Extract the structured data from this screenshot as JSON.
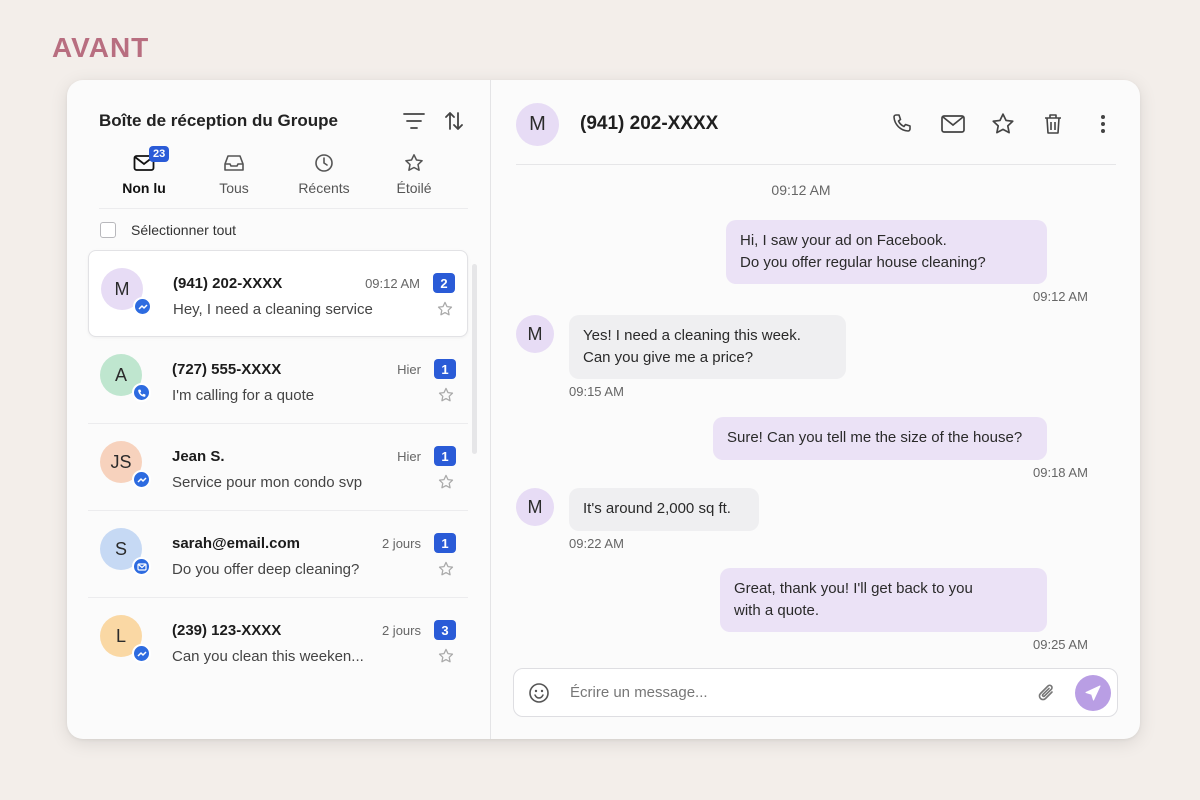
{
  "brand": {
    "label": "AVANT"
  },
  "inbox": {
    "title": "Boîte de réception du Groupe",
    "tabs": [
      {
        "label": "Non lu",
        "badge": "23",
        "icon": "mail-icon"
      },
      {
        "label": "Tous",
        "icon": "inbox-icon"
      },
      {
        "label": "Récents",
        "icon": "clock-icon"
      },
      {
        "label": "Étoilé",
        "icon": "star-icon"
      }
    ],
    "select_all": "Sélectionner tout",
    "conversations": [
      {
        "initial": "M",
        "name": "(941) 202-XXXX",
        "time": "09:12 AM",
        "badge": "2",
        "message": "Hey, I need a cleaning service",
        "avatar_color": "#e7dcf5",
        "channel": "messenger-icon"
      },
      {
        "initial": "A",
        "name": "(727) 555-XXXX",
        "time": "Hier",
        "badge": "1",
        "message": "I'm calling for a quote",
        "avatar_color": "#bfe6cf",
        "channel": "phone-icon"
      },
      {
        "initial": "JS",
        "name": "Jean S.",
        "time": "Hier",
        "badge": "1",
        "message": "Service pour mon condo svp",
        "avatar_color": "#f7d2bd",
        "channel": "messenger-icon"
      },
      {
        "initial": "S",
        "name": "sarah@email.com",
        "time": "2 jours",
        "badge": "1",
        "message": "Do you offer deep cleaning?",
        "avatar_color": "#c6d9f4",
        "channel": "email-icon"
      },
      {
        "initial": "L",
        "name": "(239) 123-XXXX",
        "time": "2 jours",
        "badge": "3",
        "message": "Can you clean this weeken...",
        "avatar_color": "#fad8a4",
        "channel": "messenger-icon"
      }
    ]
  },
  "chat": {
    "avatar_initial": "M",
    "title": "(941) 202-XXXX",
    "day_time": "09:12 AM",
    "messages": [
      {
        "dir": "out",
        "lines": [
          "Hi, I saw your ad on Facebook.",
          "Do you offer regular house cleaning?"
        ],
        "time": "09:12 AM"
      },
      {
        "dir": "in",
        "lines": [
          "Yes! I need a cleaning this week.",
          "Can you give me a price?"
        ],
        "time": "09:15 AM",
        "avatar": "M"
      },
      {
        "dir": "out",
        "lines": [
          "Sure! Can you tell me the size of the house?"
        ],
        "time": "09:18 AM"
      },
      {
        "dir": "in",
        "lines": [
          "It's around 2,000 sq ft."
        ],
        "time": "09:22 AM",
        "avatar": "M"
      },
      {
        "dir": "out",
        "lines": [
          "Great, thank you! I'll get back to you",
          "with a quote."
        ],
        "time": "09:25 AM"
      }
    ],
    "composer_placeholder": "Écrire un message..."
  },
  "colors": {
    "accent": "#2a5bd7",
    "brand": "#b86e80",
    "bubble_out": "#ebe2f6",
    "bubble_in": "#efeff1",
    "send": "#b99ee4"
  }
}
